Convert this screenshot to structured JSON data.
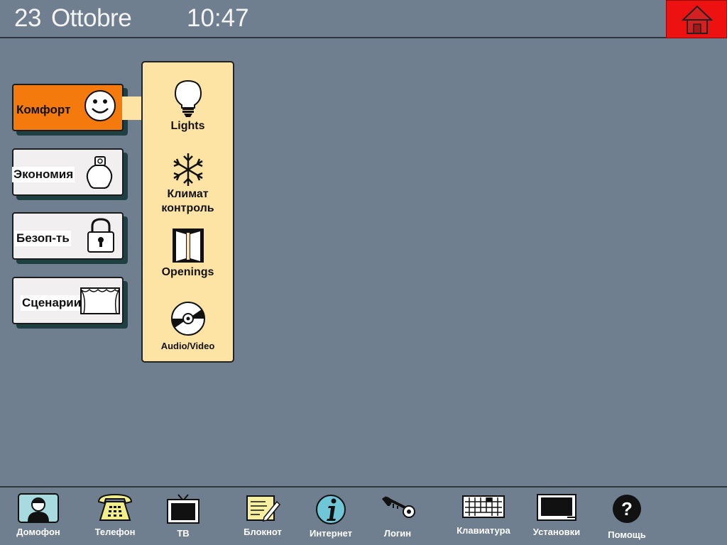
{
  "header": {
    "day": "23",
    "month": "Ottobre",
    "time": "10:47",
    "home_icon": "home-icon",
    "home_color": "#ee1111"
  },
  "modes": [
    {
      "label": "Комфорт",
      "icon": "smiley-icon",
      "active": true
    },
    {
      "label": "Экономия",
      "icon": "piggy-bank-icon",
      "active": false
    },
    {
      "label": "Безоп-ть",
      "icon": "padlock-icon",
      "active": false
    },
    {
      "label": "Сценарии",
      "icon": "theater-stage-icon",
      "active": false
    }
  ],
  "submenu": [
    {
      "label": "Lights",
      "icon": "light-bulb-icon"
    },
    {
      "label_line1": "Климат",
      "label_line2": "контроль",
      "icon": "snowflake-icon"
    },
    {
      "label": "Openings",
      "icon": "door-icon"
    },
    {
      "label": "Audio/Video",
      "icon": "cd-disc-icon"
    }
  ],
  "dock": [
    {
      "label": "Домофон",
      "icon": "intercom-person-icon"
    },
    {
      "label": "Телефон",
      "icon": "telephone-icon"
    },
    {
      "label": "ТВ",
      "icon": "tv-icon"
    },
    {
      "label": "Блокнот",
      "icon": "notepad-icon"
    },
    {
      "label": "Интернет",
      "icon": "internet-icon"
    },
    {
      "label": "Логин",
      "icon": "key-icon"
    },
    {
      "label": "Клавиатура",
      "icon": "keyboard-icon"
    },
    {
      "label": "Установки",
      "icon": "monitor-settings-icon"
    },
    {
      "label": "Помощь",
      "icon": "help-icon"
    }
  ],
  "colors": {
    "background": "#6f7f8f",
    "active_mode": "#f57a0e",
    "panel": "#fde3a4",
    "button": "#f1eff0"
  }
}
